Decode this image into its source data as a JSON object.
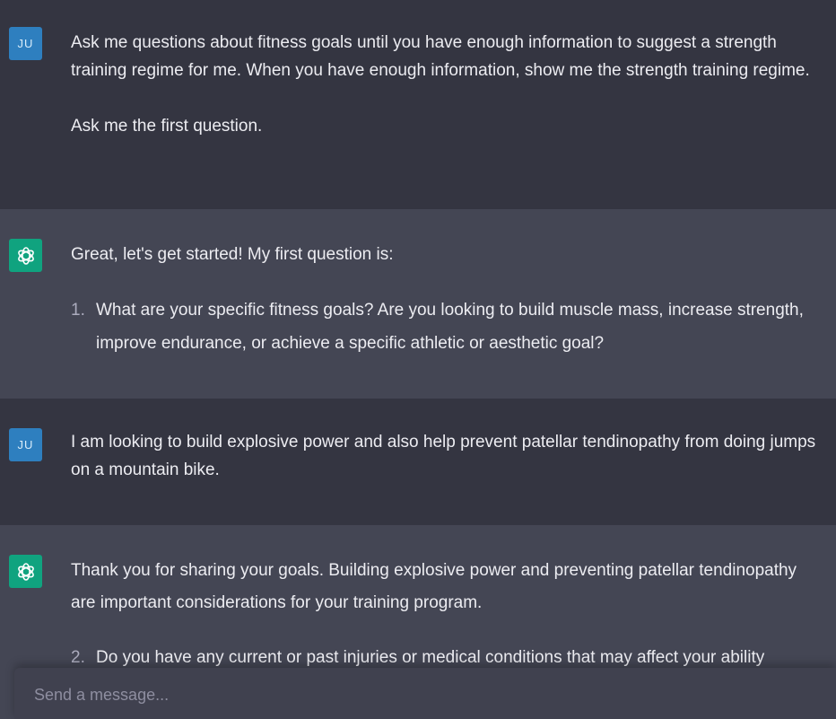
{
  "conversation": {
    "user_initials": "JU",
    "messages": [
      {
        "role": "user",
        "paragraphs": [
          "Ask me questions about fitness goals until you have enough information to suggest a strength training regime for me. When you have enough information, show me the strength training regime.",
          "Ask me the first question."
        ]
      },
      {
        "role": "assistant",
        "intro": "Great, let's get started! My first question is:",
        "list_number": "1.",
        "list_text": "What are your specific fitness goals? Are you looking to build muscle mass, increase strength, improve endurance, or achieve a specific athletic or aesthetic goal?"
      },
      {
        "role": "user",
        "paragraphs": [
          "I am looking to build explosive power and also help prevent patellar tendinopathy from doing jumps on a mountain bike."
        ]
      },
      {
        "role": "assistant",
        "intro": "Thank you for sharing your goals. Building explosive power and preventing patellar tendinopathy are important considerations for your training program.",
        "list_number": "2.",
        "list_text": "Do you have any current or past injuries or medical conditions that may affect your ability"
      }
    ]
  },
  "composer": {
    "placeholder": "Send a message..."
  },
  "colors": {
    "user_bg": "#343541",
    "assistant_bg": "#444654",
    "assistant_avatar": "#10a37f",
    "user_avatar": "#2e7fbf"
  },
  "icons": {
    "assistant_avatar": "openai-logo-icon"
  }
}
